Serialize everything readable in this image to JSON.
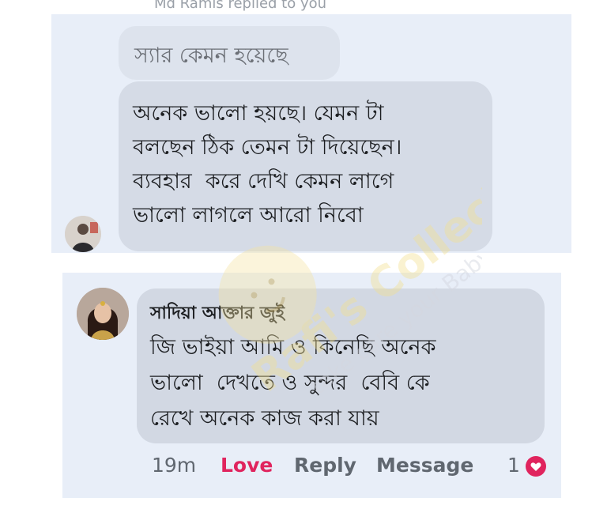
{
  "thread": {
    "faded_header": "Md Ramis replied to you",
    "quoted_message": "স্যার কেমন হয়েছে",
    "reply_lines": "অনেক ভালো হয়ছে। যেমন টা\nবলছেন ঠিক তেমন টা দিয়েছেন।\nব্যবহার  করে দেখি কেমন লাগে\nভালো লাগলে আরো নিবো"
  },
  "comment": {
    "author": "সাদিয়া আক্তার জুই",
    "text": "জি ভাইয়া আমি ও কিনেছি অনেক\nভালো  দেখতে ও সুন্দর  বেবি কে\nরেখে অনেক কাজ করা যায়",
    "time": "19m",
    "love_label": "Love",
    "reply_label": "Reply",
    "message_label": "Message",
    "reaction_count": "1",
    "reaction_icon": "heart-icon"
  },
  "watermark": {
    "brand_line": "Rafi's Collection",
    "tagline": "take care your Baby"
  },
  "colors": {
    "panel_bg": "#e8eef8",
    "bubble_bg": "#d5dbe6",
    "love": "#e0245e",
    "action_gray": "#606770"
  }
}
